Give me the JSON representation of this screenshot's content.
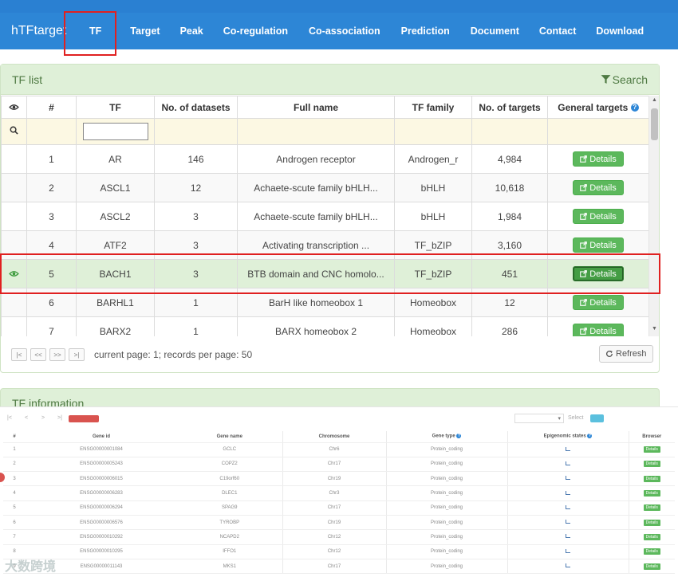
{
  "navbar": {
    "brand": "hTFtarget",
    "items": [
      "TF",
      "Target",
      "Peak",
      "Co-regulation",
      "Co-association",
      "Prediction",
      "Document",
      "Contact",
      "Download"
    ]
  },
  "tf_list": {
    "title": "TF list",
    "search_label": "Search",
    "columns": [
      "#",
      "TF",
      "No. of datasets",
      "Full name",
      "TF family",
      "No. of targets",
      "General targets"
    ],
    "details_label": "Details",
    "rows": [
      {
        "n": "1",
        "tf": "AR",
        "datasets": "146",
        "full_name": "Androgen receptor",
        "family": "Androgen_r",
        "targets": "4,984",
        "selected": false
      },
      {
        "n": "2",
        "tf": "ASCL1",
        "datasets": "12",
        "full_name": "Achaete-scute family bHLH...",
        "family": "bHLH",
        "targets": "10,618",
        "selected": false
      },
      {
        "n": "3",
        "tf": "ASCL2",
        "datasets": "3",
        "full_name": "Achaete-scute family bHLH...",
        "family": "bHLH",
        "targets": "1,984",
        "selected": false
      },
      {
        "n": "4",
        "tf": "ATF2",
        "datasets": "3",
        "full_name": "Activating transcription ...",
        "family": "TF_bZIP",
        "targets": "3,160",
        "selected": false
      },
      {
        "n": "5",
        "tf": "BACH1",
        "datasets": "3",
        "full_name": "BTB domain and CNC homolo...",
        "family": "TF_bZIP",
        "targets": "451",
        "selected": true
      },
      {
        "n": "6",
        "tf": "BARHL1",
        "datasets": "1",
        "full_name": "BarH like homeobox 1",
        "family": "Homeobox",
        "targets": "12",
        "selected": false
      },
      {
        "n": "7",
        "tf": "BARX2",
        "datasets": "1",
        "full_name": "BARX homeobox 2",
        "family": "Homeobox",
        "targets": "286",
        "selected": false
      }
    ],
    "pager_buttons": [
      "|<",
      "<<",
      ">>",
      ">|"
    ],
    "pager_text": "current page: 1; records per page: 50",
    "refresh_label": "Refresh"
  },
  "tf_info": {
    "title": "TF information"
  },
  "gene_table": {
    "toolbar_buttons": [
      "|<",
      "<",
      ">",
      ">|"
    ],
    "select_label": "Select",
    "columns": [
      "#",
      "Gene id",
      "Gene name",
      "Chromosome",
      "Gene type",
      "Epigenomic states",
      "Browser"
    ],
    "browser_btn": "Details",
    "rows": [
      {
        "n": "1",
        "id": "ENSG00000001084",
        "name": "GCLC",
        "chr": "Chr6",
        "type": "Protein_coding"
      },
      {
        "n": "2",
        "id": "ENSG00000005243",
        "name": "COPZ2",
        "chr": "Chr17",
        "type": "Protein_coding"
      },
      {
        "n": "3",
        "id": "ENSG00000006015",
        "name": "C19orf60",
        "chr": "Chr19",
        "type": "Protein_coding"
      },
      {
        "n": "4",
        "id": "ENSG00000006283",
        "name": "DLEC1",
        "chr": "Chr3",
        "type": "Protein_coding"
      },
      {
        "n": "5",
        "id": "ENSG00000006294",
        "name": "SPAG9",
        "chr": "Chr17",
        "type": "Protein_coding"
      },
      {
        "n": "6",
        "id": "ENSG00000006576",
        "name": "TYROBP",
        "chr": "Chr19",
        "type": "Protein_coding"
      },
      {
        "n": "7",
        "id": "ENSG00000010292",
        "name": "NCAPD2",
        "chr": "Chr12",
        "type": "Protein_coding"
      },
      {
        "n": "8",
        "id": "ENSG00000010295",
        "name": "IFFO1",
        "chr": "Chr12",
        "type": "Protein_coding"
      },
      {
        "n": "9",
        "id": "ENSG00000011143",
        "name": "MKS1",
        "chr": "Chr17",
        "type": "Protein_coding"
      }
    ]
  },
  "watermark": "大数跨境"
}
